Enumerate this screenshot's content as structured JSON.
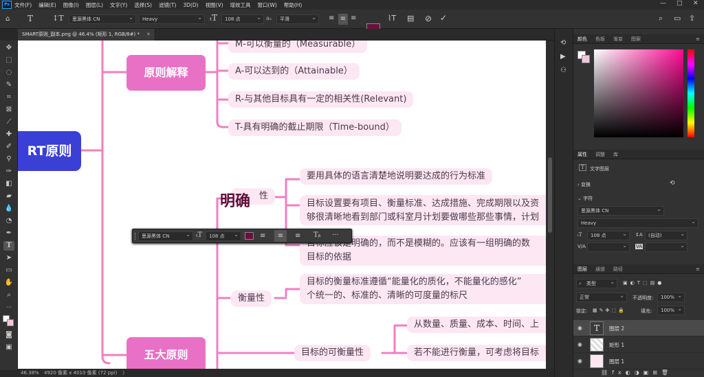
{
  "menu": {
    "app_icon": "Ps",
    "items": [
      "文件(F)",
      "编辑(E)",
      "图像(I)",
      "图层(L)",
      "文字(Y)",
      "选择(S)",
      "滤镜(T)",
      "3D(D)",
      "视图(V)",
      "增效工具",
      "窗口(W)",
      "帮助(H)"
    ],
    "window_controls": [
      "—",
      "□",
      "✕"
    ]
  },
  "options": {
    "font_family": "思源黑体 CN",
    "font_style": "Heavy",
    "font_size": "108 点",
    "aa_label": "a",
    "antialias": "平滑",
    "text_color": "#6b0f3e"
  },
  "document_tab": {
    "title": "SMART原则_副本.png @ 46.4% (矩形 1, RGB/8#) *",
    "close": "✕"
  },
  "status": {
    "zoom": "46.38%",
    "info": "4920 像素 x 4010 像素 (72 ppi)",
    "arrow": "〉"
  },
  "canvas": {
    "center_node": "RT原则",
    "principle_node": "原则解释",
    "five_node": "五大原则",
    "explanations": [
      "M-可以衡量的（Measurable）",
      "A-可以达到的（Attainable）",
      "R-与其他目标具有一定的相关性(Relevant)",
      "T-具有明确的截止期限（Time-bound）"
    ],
    "clarity_label": "性",
    "clarity_typed": "明确",
    "clarity_items": [
      "要用具体的语言清楚地说明要达成的行为标准",
      "目标设置要有项目、衡量标准、达成措施、完成期限以及资",
      "够很清晰地看到部门或科室月计划要做哪些那些事情，计划",
      "目标应该是明确的，而不是模糊的。应该有一组明确的数",
      "目标的依据"
    ],
    "measurable_label": "衡量性",
    "measurable_items": [
      "目标的衡量标准遵循“能量化的质化，不能量化的感化”",
      "个统一的、标准的、清晰的可度量的标尺"
    ],
    "measurable_sub_label": "目标的可衡量性",
    "measurable_sub_items": [
      "从数量、质量、成本、时间、上",
      "若不能进行衡量，可考虑将目标"
    ]
  },
  "floating_bar": {
    "font": "思源黑体 CN",
    "size": "108 点",
    "more": "···"
  },
  "color_panel": {
    "tabs": [
      "颜色",
      "色板",
      "渐变",
      "图案"
    ]
  },
  "properties_panel": {
    "tabs": [
      "属性",
      "调整",
      "库"
    ],
    "layer_type": "文字图层",
    "transform": "变换",
    "character": "字符",
    "font_family": "思源黑体 CN",
    "font_style": "Heavy",
    "size": "108 点",
    "leading": "(自动)",
    "kerning_label": "V/A",
    "tracking_label": "VA"
  },
  "layers_panel": {
    "tabs": [
      "图层",
      "通道",
      "路径"
    ],
    "filter": "类型",
    "blend_mode": "正常",
    "opacity_label": "不透明度:",
    "opacity": "100%",
    "lock_label": "锁定:",
    "fill_label": "填充:",
    "fill": "100%",
    "layers": [
      {
        "name": "图层 2",
        "kind": "text"
      },
      {
        "name": "矩形 1",
        "kind": "shape"
      },
      {
        "name": "图层 1",
        "kind": "image"
      }
    ]
  },
  "colors": {
    "accent_pink": "#e971c5",
    "center_blue": "#3a3fd6",
    "node_bg": "#fde7f3",
    "connector": "#f07fc0"
  }
}
